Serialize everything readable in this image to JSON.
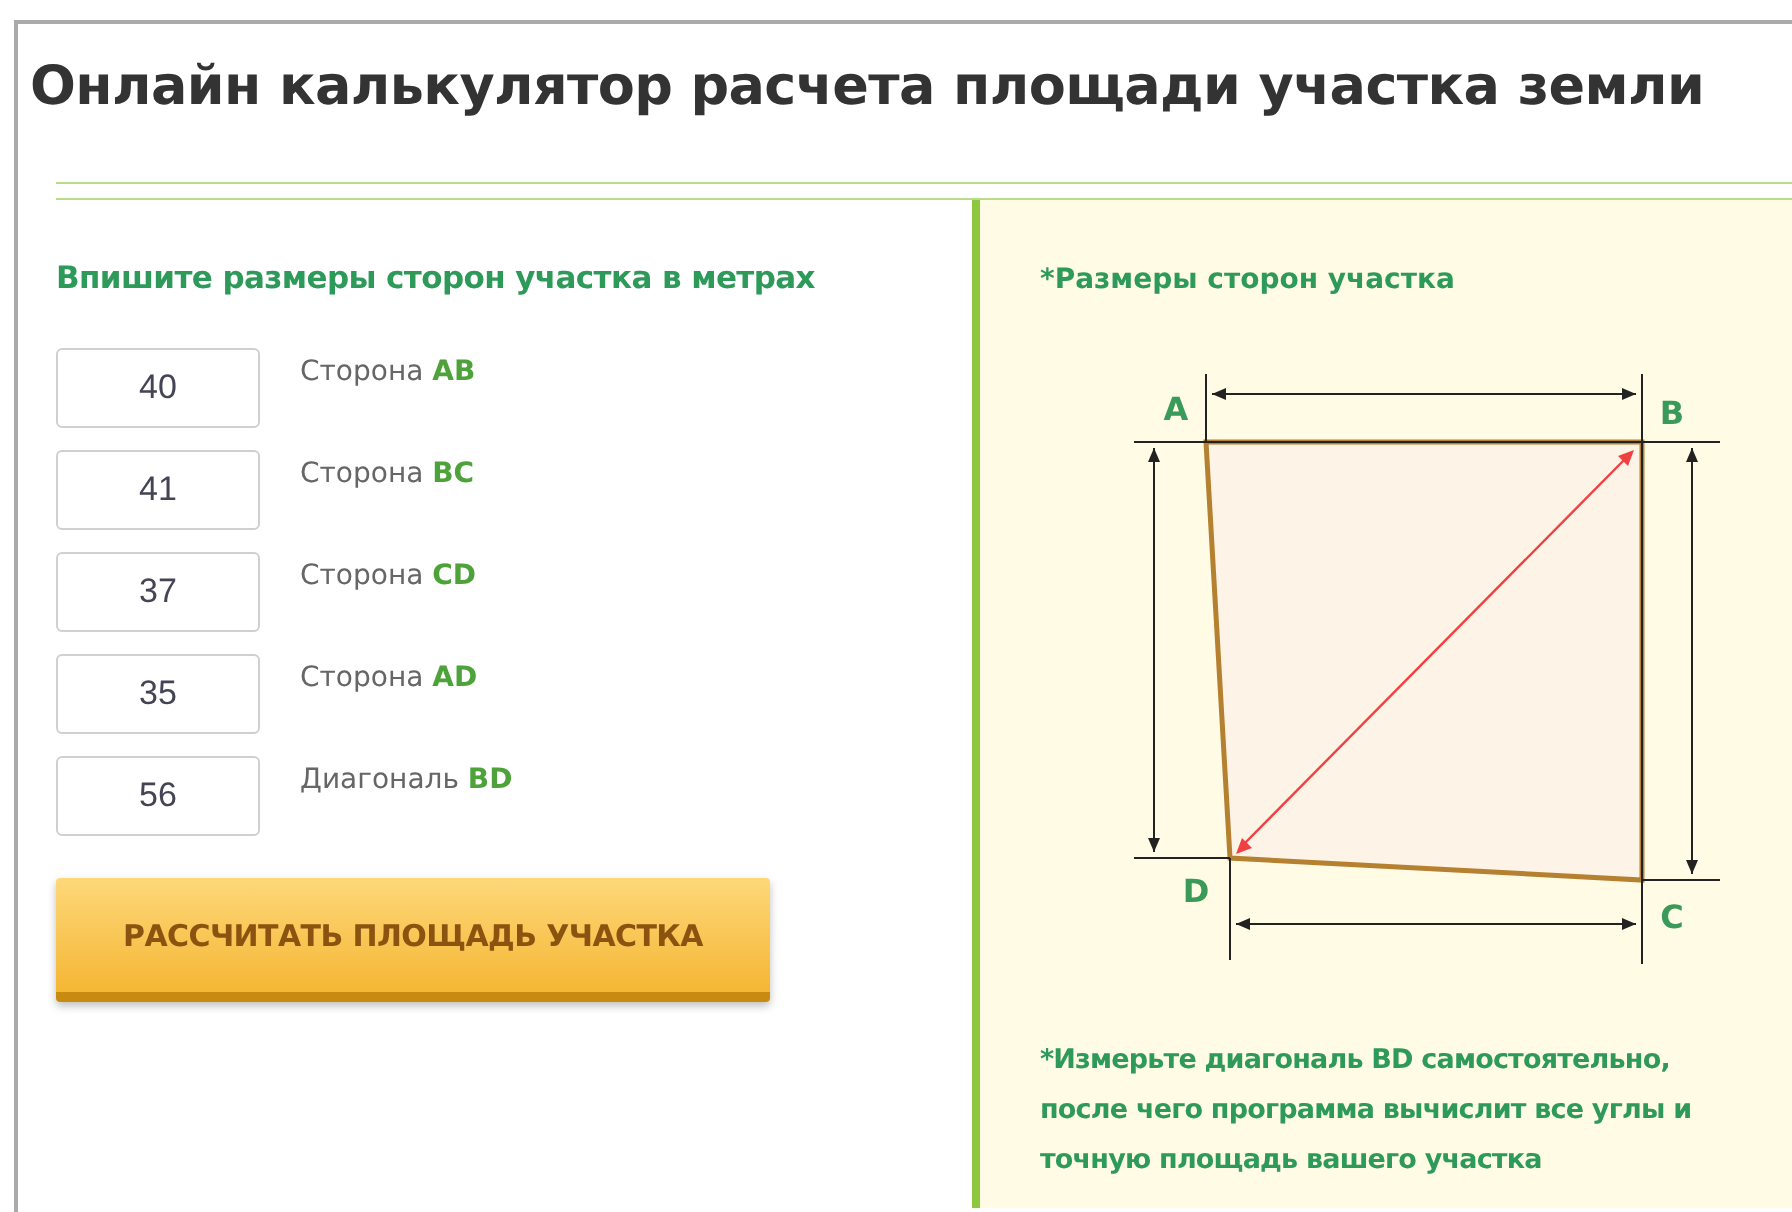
{
  "title": "Онлайн калькулятор расчета площади участка земли",
  "form": {
    "heading": "Впишите размеры сторон участка в метрах",
    "fields": [
      {
        "value": "40",
        "label": "Сторона **AB**"
      },
      {
        "value": "41",
        "label": "Сторона **BC**"
      },
      {
        "value": "37",
        "label": "Сторона **CD**"
      },
      {
        "value": "35",
        "label": "Сторона **AD**"
      },
      {
        "value": "56",
        "label": "Диагональ **BD**"
      }
    ],
    "button": "РАССЧИТАТЬ ПЛОЩАДЬ УЧАСТКА"
  },
  "info": {
    "heading": "*Размеры сторон участка",
    "corners": [
      "A",
      "B",
      "C",
      "D"
    ],
    "note_lines": [
      "*Измерьте диагональ BD   самостоятельно,",
      "после чего программа вычислит все углы и",
      "точную площадь вашего участка"
    ]
  }
}
